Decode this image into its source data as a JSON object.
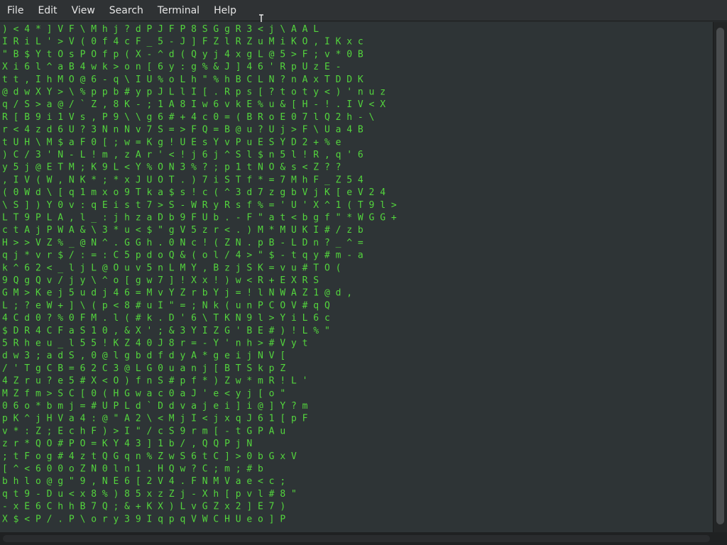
{
  "menubar": {
    "file": "File",
    "edit": "Edit",
    "view": "View",
    "search": "Search",
    "terminal": "Terminal",
    "help": "Help"
  },
  "terminal": {
    "green": "#53d53d",
    "white": "#f2f2f2",
    "background": "#2e3436",
    "lines": [
      ") <    4 * ]    V    F \\ M   h j ? d P   J F     P     8   S     G   g R   3 < j     \\     A   A L",
      "I R    i L ' >    V    ( 0 f   4 c F _ 5   - J   ]     F     Z   l   R   Z   u M   i K O     ,     I K   x c",
      "\" B    $ Y t O    s    P   O   f p ( X -   ^ d   (     Q     y   j 4 x   g   L @   5 > F     ;     v *   0 B",
      "X i    6 l ^ a    B    4   w k > o n   [ 6   y :   g     %   & J ]   4   6 '   R p U   z     E -",
      "t t ,  I h M O    @ 6    -   q \\ I U %   o L   h \"   %     h   B C L   N   ? n   A x T   D     D K",
      "@ d w  X Y >    \\ % p    p   b # y p J   L l   I [   . R   p s   [ ? t   o   t y   <  )   ' n     u z",
      "q / S  > a @    / ` Z    ,   8 K - ;   1   A 8   I w   6 v   k E   % u &   [   H   -   !   . I V     < X",
      "R [ B  9   i    1 V s    ,   P   9 \\ \\ g 6   # +   4 c   0 =   ( B   R o E       0     7   l   Q 2 h     - \\",
      "r < 4  z   d    6 U ?    3   N n N v 7   S =   > F   Q =   B @   u ? U       j     > F   \\ U a     4 B",
      "t U H  \\   M    $ a    F   0 [ ; w   = K   g !   U E   s   Y v P       u   E   S Y   D 2 +     %   e",
      ") C /  3   '    N -    L   ! m , z   A r ' < !   j 6   j   ^ S l     $   n   5   l !   R , q     '   6",
      "y 5    j   @    E T    M   ;   K 9   L < Y % O   N 3   %   ? ; p     1   t   N O   & s   < Z     ?   ?",
      ", I    V   (    W ,    N   K   * ;   * x J U O T   .   )   7 i S T   f * =   7 M   h F   _ Z     5   4",
      "( 0    W   d    \\ [    q   1   m x   o 9 T k a $ s !   c   ( ^ 3 d   7 z g   b V   j K   [ e V     2   4",
      "\\ S    ]   )  Y  0    v   :   q E   i s t 7 > S - W R y   R s f %   = '   U '   X ^   1 ( T   9 l   >",
      "L T    9   P  L A ,    l   _   :   j h z a   D b 9 F U   b . - F   \" a   t <   b g   f \" * W G G     +",
      "       c t A  j P W    A   &     \\ 3 * u   < $ \" g V   5 z   r   < .   ) M   * M   U K I # / z   b",
      "       H >    > V Z    % _   @     N ^ . G G h . 0 N c   ! (   Z   N .   p B   -   L D n ? _ ^   =",
      "       q j    * v r    $ /   :   = : C 5 p d   o Q & (   o l   /   4 >   \" $   -   t q y # m - a",
      "       k ^    6 2 <    _ l   j   L @   O u v   5 n L   M Y ,   B   z j   S   K   = v u # T O (",
      "       9 Q    g Q v    /   j   y \\   ^ o [   g w 7   ] ! X   x   ! )   w       < R + E X R S",
      "  G M  > K    e j 5    u   d   j 4 6 = M v   Y Z r   b Y j   =   ! l   N       W A Z 1 @ d ,",
      "  L ;  ? e    W +    ]   \\   ( p < 8 # u   I \"   = ; N   k   ( u   n       P C O V # q Q",
      "  4 C  d 0    ? %    0   F   M . l ( # k   . D   ' 6 \\   T   K N   9       l > Y i L 6 c",
      "  $ D  R 4    C F    a   S   1 0 , & X '   ; &   3 Y I   Z   G '   B       E # ) ! L % \"",
      "  5 R  h e    u _    l   5   5 ! K Z 4 0   J 8     r   =   - Y   '       n h > # V y t",
      "  d w  3 ;    a d    S   ,   0   @ l g b   d f     d   y A   *   g   e   i   j N V [",
      "  / '  T g    C B    =   6   2   C 3 @ L G   0 u     a   n   j   [   B   T   S k p Z",
      "  4 Z  r u    ? e    5 #   X   <   O   ) f n S   # p     f   *   )   Z w   *   m   R ! L '",
      "  M Z  f m    > S    C [   0   (   H G   w a c 0   a   J   '   e   <   y   j   [ o \"",
      "  0 6  o *    b m    j =   #   U P   L d   ` D d v   a   j   e   i   ] i   @   ]   Y ? m",
      "  p K  ^ j    H V    a 4   :   @ \"   A 2   \\ < M j   I   <   j   x   q J   6   1   [ p F",
      "  v *  : Z    ;    E c   h   F )   > I   \"   /   c   S   9   r m   [ - t   G   P   A u",
      "  z r  * Q    O    # P O   =   K   Y   4   3   ]   1   b /   , Q   Q   P   j N",
      "  ; t F o g    #    4 z t   Q   G   q   n %   Z   w S   6   t C   ] >   0 b G   x V",
      "  [ ^ < 6 0    0    o Z N   0   l   n   1 .   H Q   w   ?   C ;   m ;   # b",
      "  b h l o @ g    \"    9 , N E   6   [ 2   V 4   . F   N   M   V a   e <   c ;",
      "  q t 9 - D u    < x    8 % ) 8   5   x z   Z j   - X   h   [   p v   l #   8 \"",
      "  - x E 6 C h    h B    7 Q ; &   +   K X   )   L v   G   Z   x   2 ]   E   7 )",
      "  X $ < P / .    P \\    o r y 3   9   I q   p   q V   W   C   H   U e   o   ] P"
    ]
  }
}
